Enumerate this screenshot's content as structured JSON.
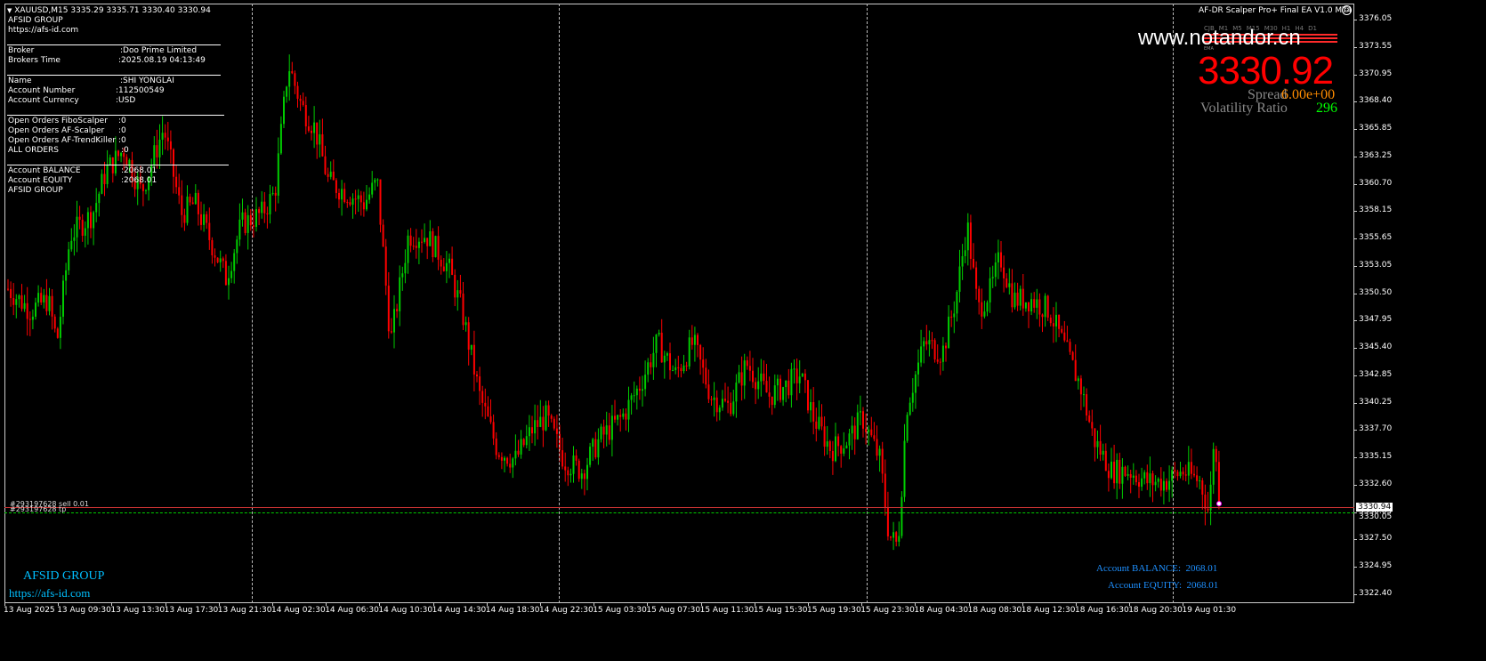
{
  "header": {
    "symbol_line": "XAUUSD,M15  3335.29 3335.71 3330.40 3330.94",
    "ea_title": "AF-DR Scalper Pro+ Final EA V1.0 MT4"
  },
  "info_panel": {
    "company": "AFSID GROUP",
    "website": "https://afs-id.com",
    "broker_label": "Broker",
    "broker_value": ":Doo Prime Limited",
    "broker_time_label": "Brokers Time",
    "broker_time_value": ":2025.08.19 04:13:49",
    "name_label": "Name",
    "name_value": ":SHI YONGLAI",
    "account_number_label": "Account Number",
    "account_number_value": ":112500549",
    "account_currency_label": "Account Currency",
    "account_currency_value": ":USD",
    "orders_fibo_label": "Open Orders FiboScalper",
    "orders_fibo_value": ":0",
    "orders_scalper_label": "Open Orders AF-Scalper",
    "orders_scalper_value": ":0",
    "orders_trend_label": "Open Orders AF-TrendKiller",
    "orders_trend_value": ":0",
    "all_orders_label": "ALL ORDERS",
    "all_orders_value": ":0",
    "balance_label": "Account BALANCE",
    "balance_value": ":2068.01",
    "equity_label": "Account EQUITY",
    "equity_value": ":2068.01",
    "footer_company": "AFSID GROUP"
  },
  "right_panel": {
    "watermark": "www.notandor.cn",
    "timeframes": [
      "CJB",
      "M1",
      "M5",
      "M15",
      "M30",
      "H1",
      "H4",
      "D1"
    ],
    "ema_label": "EMA",
    "price": "3330.92",
    "spread_label": "Spread",
    "spread_value": "6.00e+00",
    "volatility_label": "Volatility Ratio",
    "volatility_value": "296"
  },
  "order_lines": {
    "sell_label": "#293197628 sell 0.01",
    "tp_label": "#293197628 tp"
  },
  "bottom_left": {
    "company": "AFSID GROUP",
    "website": "https://afs-id.com"
  },
  "bottom_right": {
    "balance_label": "Account BALANCE:",
    "balance_value": "2068.01",
    "equity_label": "Account EQUITY:",
    "equity_value": "2068.01"
  },
  "price_axis": {
    "current_price": "3330.94",
    "tp_price": "3330.05",
    "ticks": [
      "3376.05",
      "3373.55",
      "3370.95",
      "3368.40",
      "3365.85",
      "3363.25",
      "3360.70",
      "3358.15",
      "3355.65",
      "3353.05",
      "3350.50",
      "3347.95",
      "3345.40",
      "3342.85",
      "3340.25",
      "3337.70",
      "3335.15",
      "3332.60",
      "3330.05",
      "3327.50",
      "3324.95",
      "3322.40"
    ]
  },
  "time_axis": {
    "labels": [
      "13 Aug 2025",
      "13 Aug 09:30",
      "13 Aug 13:30",
      "13 Aug 17:30",
      "13 Aug 21:30",
      "14 Aug 02:30",
      "14 Aug 06:30",
      "14 Aug 10:30",
      "14 Aug 14:30",
      "14 Aug 18:30",
      "14 Aug 22:30",
      "15 Aug 03:30",
      "15 Aug 07:30",
      "15 Aug 11:30",
      "15 Aug 15:30",
      "15 Aug 19:30",
      "15 Aug 23:30",
      "18 Aug 04:30",
      "18 Aug 08:30",
      "18 Aug 12:30",
      "18 Aug 16:30",
      "18 Aug 20:30",
      "19 Aug 01:30"
    ]
  },
  "colors": {
    "bull": "#00cc00",
    "bear": "#ff0000",
    "price_big": "#ff0000",
    "spread_value": "#ff8c00",
    "volatility_value": "#00ff00",
    "info_blue": "#00bfff"
  },
  "chart_data": {
    "type": "candlestick",
    "symbol": "XAUUSD",
    "timeframe": "M15",
    "ylim": [
      3322.4,
      3376.05
    ],
    "current_price": 3330.94,
    "tp_level": 3330.05,
    "anchors": [
      [
        0,
        3351
      ],
      [
        25,
        3349
      ],
      [
        45,
        3350
      ],
      [
        55,
        3346
      ],
      [
        70,
        3356
      ],
      [
        95,
        3358
      ],
      [
        110,
        3362
      ],
      [
        130,
        3364
      ],
      [
        150,
        3360
      ],
      [
        175,
        3366
      ],
      [
        195,
        3358
      ],
      [
        210,
        3359
      ],
      [
        230,
        3355
      ],
      [
        245,
        3352
      ],
      [
        262,
        3357
      ],
      [
        285,
        3358
      ],
      [
        300,
        3360
      ],
      [
        315,
        3372
      ],
      [
        330,
        3368
      ],
      [
        345,
        3366
      ],
      [
        360,
        3361
      ],
      [
        380,
        3360
      ],
      [
        400,
        3359
      ],
      [
        415,
        3361
      ],
      [
        430,
        3346
      ],
      [
        450,
        3356
      ],
      [
        470,
        3356
      ],
      [
        495,
        3353
      ],
      [
        510,
        3349
      ],
      [
        530,
        3341
      ],
      [
        550,
        3336
      ],
      [
        570,
        3335
      ],
      [
        590,
        3338
      ],
      [
        605,
        3339
      ],
      [
        625,
        3335
      ],
      [
        645,
        3334
      ],
      [
        665,
        3337
      ],
      [
        690,
        3339
      ],
      [
        710,
        3342
      ],
      [
        730,
        3346
      ],
      [
        750,
        3343
      ],
      [
        770,
        3346
      ],
      [
        790,
        3341
      ],
      [
        810,
        3340
      ],
      [
        830,
        3344
      ],
      [
        855,
        3341
      ],
      [
        875,
        3342
      ],
      [
        890,
        3343
      ],
      [
        905,
        3339
      ],
      [
        925,
        3336
      ],
      [
        945,
        3337
      ],
      [
        960,
        3339
      ],
      [
        980,
        3335
      ],
      [
        990,
        3328
      ],
      [
        1000,
        3327
      ],
      [
        1010,
        3340
      ],
      [
        1030,
        3346
      ],
      [
        1050,
        3345
      ],
      [
        1065,
        3350
      ],
      [
        1078,
        3357
      ],
      [
        1090,
        3349
      ],
      [
        1105,
        3351
      ],
      [
        1115,
        3354
      ],
      [
        1130,
        3350
      ],
      [
        1150,
        3350
      ],
      [
        1170,
        3349
      ],
      [
        1190,
        3345
      ],
      [
        1205,
        3342
      ],
      [
        1220,
        3337
      ],
      [
        1240,
        3334
      ],
      [
        1260,
        3334
      ],
      [
        1280,
        3333
      ],
      [
        1300,
        3333
      ],
      [
        1320,
        3334
      ],
      [
        1340,
        3333
      ],
      [
        1350,
        3330
      ],
      [
        1355,
        3337
      ],
      [
        1362,
        3331
      ]
    ]
  }
}
